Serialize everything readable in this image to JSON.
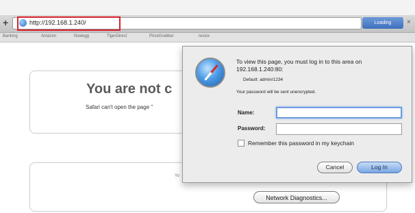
{
  "toolbar": {
    "url": "http://192.168.1.240/",
    "loading_label": "Loading"
  },
  "bookmarks": [
    "Banking",
    "Amazon",
    "Nowegg",
    "TigerDirect",
    "PriceGrabber",
    "resize"
  ],
  "error_page": {
    "title": "You are not c",
    "body": "Safari can't open the page \"",
    "second_card_text": "Yo",
    "network_diagnostics_label": "Network Diagnostics..."
  },
  "login_dialog": {
    "message": "To view this page, you must log in to this area on 192.168.1.240:80:",
    "default_credentials": "Default: admin/1234",
    "unencrypted_notice": "Your password will be sent unencrypted.",
    "name_label": "Name:",
    "name_value": "",
    "password_label": "Password:",
    "password_value": "",
    "remember_label": "Remember this password in my keychain",
    "remember_checked": false,
    "cancel_label": "Cancel",
    "login_label": "Log In"
  },
  "colors": {
    "url_highlight": "#d9232e",
    "accent_blue": "#6b9be0"
  }
}
